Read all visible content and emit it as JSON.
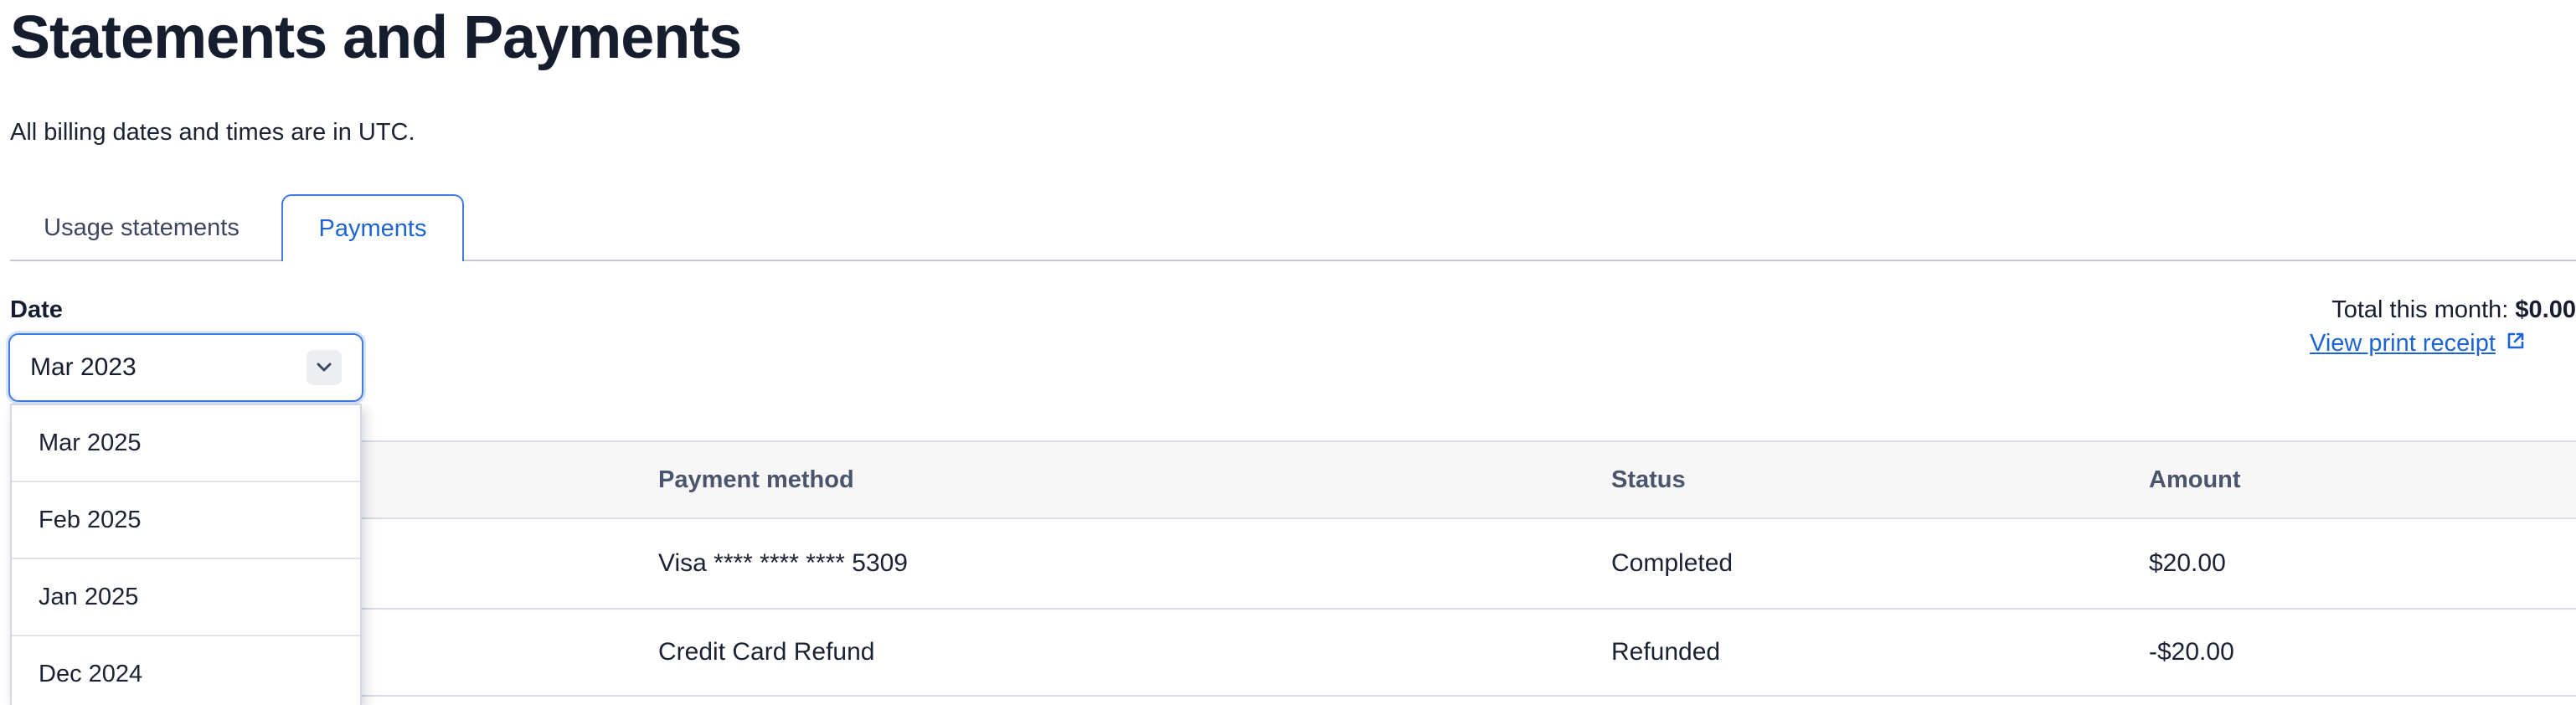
{
  "page": {
    "title": "Statements and Payments",
    "subtitle": "All billing dates and times are in UTC."
  },
  "tabs": [
    {
      "label": "Usage statements",
      "active": false
    },
    {
      "label": "Payments",
      "active": true
    }
  ],
  "filter": {
    "label": "Date",
    "selected": "Mar 2023",
    "options": [
      "Mar 2025",
      "Feb 2025",
      "Jan 2025",
      "Dec 2024"
    ]
  },
  "summary": {
    "total_label": "Total this month:",
    "total_value": "$0.00",
    "receipt_link": "View print receipt"
  },
  "table": {
    "columns": [
      "Payment method",
      "Status",
      "Amount"
    ],
    "rows": [
      {
        "method": "Visa **** **** **** 5309",
        "status": "Completed",
        "amount": "$20.00"
      },
      {
        "method": "Credit Card Refund",
        "status": "Refunded",
        "amount": "-$20.00"
      }
    ]
  },
  "colors": {
    "accent": "#1c64d4",
    "focus_border": "#3f7ae5",
    "title": "#161d2f",
    "header_bg": "#f7f7f8"
  }
}
